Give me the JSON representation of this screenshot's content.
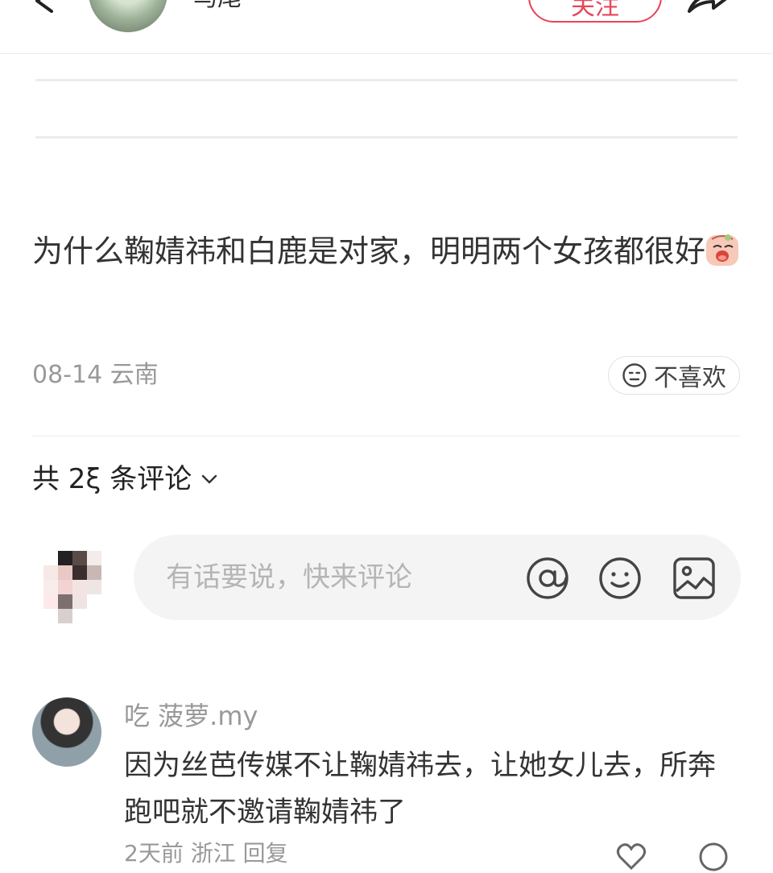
{
  "header": {
    "author_name": "马尾",
    "follow_label": "关注"
  },
  "post": {
    "title": "为什么鞠婧祎和白鹿是对家，明明两个女孩都很好",
    "date": "08-14",
    "location": "云南",
    "dislike_label": "不喜欢"
  },
  "comments": {
    "count_label": "共 2ξ 条评论",
    "input_placeholder": "有话要说，快来评论",
    "items": [
      {
        "user": "吃  菠萝.my",
        "text": "因为丝芭传媒不让鞠婧祎去，让她女儿去，所奔跑吧就不邀请鞠婧祎了",
        "meta": "2天前 浙江 回复"
      }
    ]
  },
  "colors": {
    "accent": "#e8455a",
    "muted": "#999999"
  },
  "icons": [
    "back-icon",
    "share-icon",
    "sad-emoji-icon",
    "neutral-face-icon",
    "chevron-down-icon",
    "at-icon",
    "emoji-icon",
    "image-icon",
    "like-icon",
    "reply-icon"
  ]
}
